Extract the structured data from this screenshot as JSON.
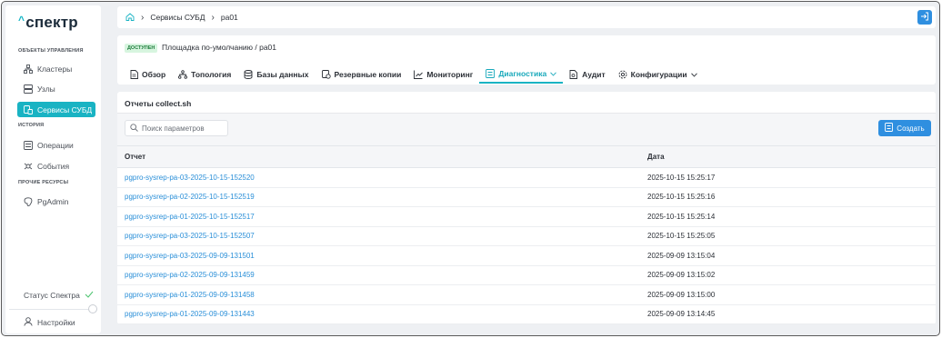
{
  "app": {
    "logo": "спектр"
  },
  "sidebar": {
    "sections": {
      "management": "ОБЪЕКТЫ УПРАВЛЕНИЯ",
      "history": "ИСТОРИЯ",
      "other": "ПРОЧИЕ РЕСУРСЫ"
    },
    "items": [
      {
        "label": "Кластеры",
        "icon": "cluster-icon"
      },
      {
        "label": "Узлы",
        "icon": "server-icon"
      },
      {
        "label": "Сервисы СУБД",
        "icon": "db-service-icon"
      },
      {
        "label": "Операции",
        "icon": "operations-icon"
      },
      {
        "label": "События",
        "icon": "events-icon"
      },
      {
        "label": "PgAdmin",
        "icon": "pgadmin-icon"
      }
    ],
    "status_label": "Статус Спектра",
    "settings_label": "Настройки"
  },
  "breadcrumb": {
    "part1": "Сервисы СУБД",
    "part2": "pa01"
  },
  "header": {
    "badge": "ДОСТУПЕН",
    "place": "Площадка по-умолчанию /  pa01"
  },
  "tabs": [
    {
      "label": "Обзор"
    },
    {
      "label": "Топология"
    },
    {
      "label": "Базы данных"
    },
    {
      "label": "Резервные копии"
    },
    {
      "label": "Мониторинг"
    },
    {
      "label": "Диагностика"
    },
    {
      "label": "Аудит"
    },
    {
      "label": "Конфигурации"
    }
  ],
  "content": {
    "title": "Отчеты collect.sh",
    "search_placeholder": "Поиск параметров",
    "create_label": "Создать",
    "columns": {
      "report": "Отчет",
      "date": "Дата"
    },
    "rows": [
      {
        "report": "pgpro-sysrep-pa-03-2025-10-15-152520",
        "date": "2025-10-15 15:25:17"
      },
      {
        "report": "pgpro-sysrep-pa-02-2025-10-15-152519",
        "date": "2025-10-15 15:25:16"
      },
      {
        "report": "pgpro-sysrep-pa-01-2025-10-15-152517",
        "date": "2025-10-15 15:25:14"
      },
      {
        "report": "pgpro-sysrep-pa-03-2025-10-15-152507",
        "date": "2025-10-15 15:25:05"
      },
      {
        "report": "pgpro-sysrep-pa-03-2025-09-09-131501",
        "date": "2025-09-09 13:15:04"
      },
      {
        "report": "pgpro-sysrep-pa-02-2025-09-09-131459",
        "date": "2025-09-09 13:15:02"
      },
      {
        "report": "pgpro-sysrep-pa-01-2025-09-09-131458",
        "date": "2025-09-09 13:15:00"
      },
      {
        "report": "pgpro-sysrep-pa-01-2025-09-09-131443",
        "date": "2025-09-09 13:14:45"
      }
    ]
  },
  "colors": {
    "accent": "#19b3c3",
    "primary_button": "#2f8fe0",
    "link": "#2a8fd8",
    "badge_bg": "#d7f5df"
  }
}
